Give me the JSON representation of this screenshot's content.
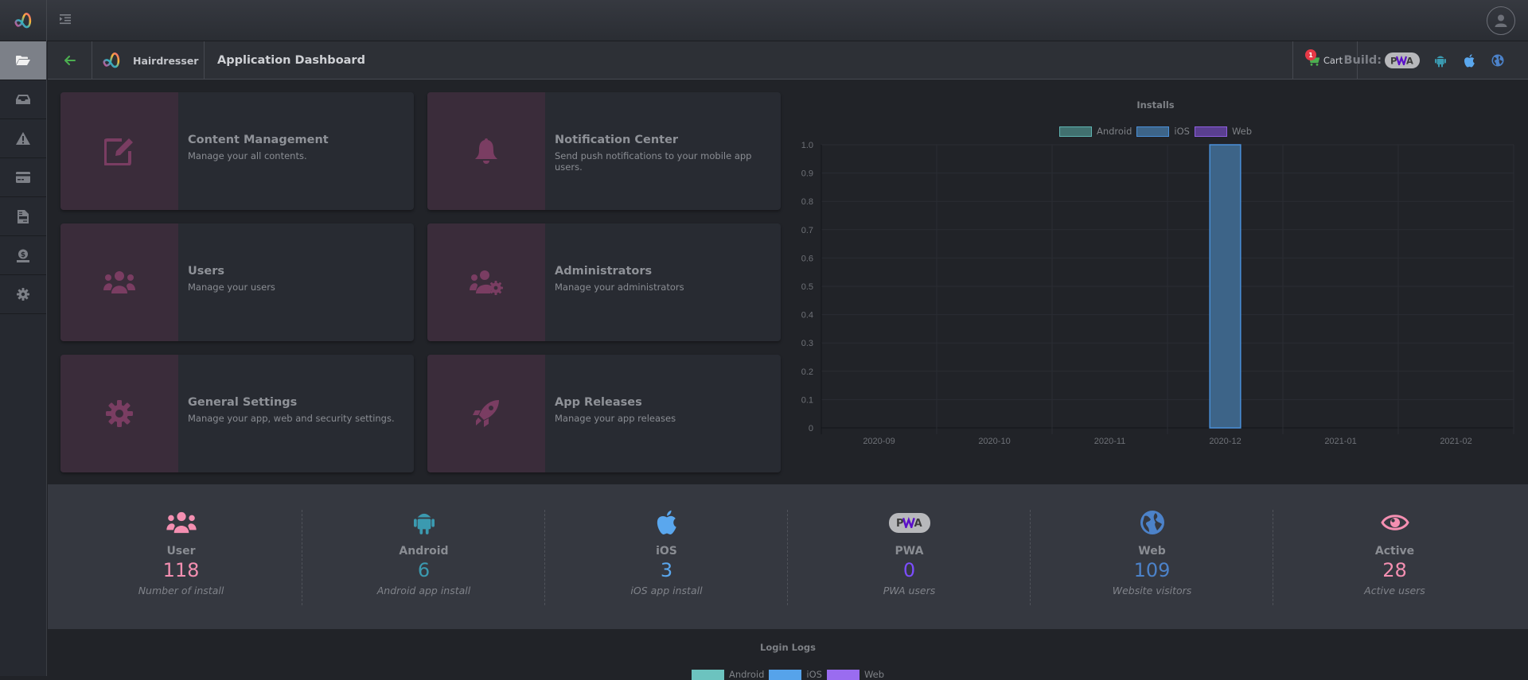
{
  "topbar": {
    "menu_toggle_icon": "indent-icon",
    "avatar_icon": "user-icon"
  },
  "sidebar": {
    "items": [
      {
        "name": "folder-open",
        "active": true
      },
      {
        "name": "inbox",
        "active": false
      },
      {
        "name": "warning",
        "active": false
      },
      {
        "name": "credit-card",
        "active": false
      },
      {
        "name": "file-invoice",
        "active": false
      },
      {
        "name": "money-hand",
        "active": false
      },
      {
        "name": "gear",
        "active": false
      }
    ]
  },
  "subheader": {
    "app_name": "Hairdresser",
    "page_title": "Application Dashboard",
    "cart_label": "Cart",
    "cart_count": "1",
    "build_label": "Build:",
    "pwa_label": "PWA"
  },
  "cards": [
    {
      "title": "Content Management",
      "desc": "Manage your all contents.",
      "icon": "edit-icon"
    },
    {
      "title": "Notification Center",
      "desc": "Send push notifications to your mobile app users.",
      "icon": "bell-icon"
    },
    {
      "title": "Users",
      "desc": "Manage your users",
      "icon": "users-icon"
    },
    {
      "title": "Administrators",
      "desc": "Manage your administrators",
      "icon": "users-cog-icon"
    },
    {
      "title": "General Settings",
      "desc": "Manage your app, web and security settings.",
      "icon": "cog-icon"
    },
    {
      "title": "App Releases",
      "desc": "Manage your app releases",
      "icon": "rocket-icon"
    }
  ],
  "colors": {
    "android": "#4fa3a5",
    "ios": "#4a90d9",
    "web": "#8e5ee0",
    "pink": "#f48fb1",
    "android_icon": "#3b9ab0",
    "ios_icon": "#5aa7ee",
    "pwa_value": "#7c4dff",
    "web_icon": "#4c82c9",
    "card_icon": "#7a3d62",
    "accent_green": "#4caf50"
  },
  "chart_data": {
    "type": "bar",
    "title": "Installs",
    "categories": [
      "2020-09",
      "2020-10",
      "2020-11",
      "2020-12",
      "2021-01",
      "2021-02"
    ],
    "series": [
      {
        "name": "Android",
        "values": [
          0,
          0,
          0,
          0,
          0,
          0
        ],
        "fill": "#41706f",
        "stroke": "#5fb3b1"
      },
      {
        "name": "iOS",
        "values": [
          0,
          0,
          0,
          1,
          0,
          0
        ],
        "fill": "#3d6488",
        "stroke": "#4a90d9"
      },
      {
        "name": "Web",
        "values": [
          0,
          0,
          0,
          0,
          0,
          0
        ],
        "fill": "#5a3f8f",
        "stroke": "#8e5ee0"
      }
    ],
    "ylim": [
      0,
      1
    ],
    "yticks": [
      "0",
      "0.1",
      "0.2",
      "0.3",
      "0.4",
      "0.5",
      "0.6",
      "0.7",
      "0.8",
      "0.9",
      "1.0"
    ],
    "xlabel": "",
    "ylabel": "",
    "grid": true,
    "legend": "top"
  },
  "stats": [
    {
      "label": "User",
      "value": "118",
      "desc": "Number of install",
      "icon": "users-icon",
      "color": "#f48fb1"
    },
    {
      "label": "Android",
      "value": "6",
      "desc": "Android app install",
      "icon": "android-icon",
      "color": "#3b9ab0"
    },
    {
      "label": "iOS",
      "value": "3",
      "desc": "iOS app install",
      "icon": "apple-icon",
      "color": "#5aa7ee"
    },
    {
      "label": "PWA",
      "value": "0",
      "desc": "PWA users",
      "icon": "pwa-icon",
      "color": "#7c4dff"
    },
    {
      "label": "Web",
      "value": "109",
      "desc": "Website visitors",
      "icon": "globe-icon",
      "color": "#4c82c9"
    },
    {
      "label": "Active",
      "value": "28",
      "desc": "Active users",
      "icon": "eye-icon",
      "color": "#f48fb1"
    }
  ],
  "login_logs": {
    "title": "Login Logs",
    "legend": [
      {
        "name": "Android",
        "color": "#6cc3bf"
      },
      {
        "name": "iOS",
        "color": "#56a3ea"
      },
      {
        "name": "Web",
        "color": "#9a6cf0"
      }
    ]
  }
}
